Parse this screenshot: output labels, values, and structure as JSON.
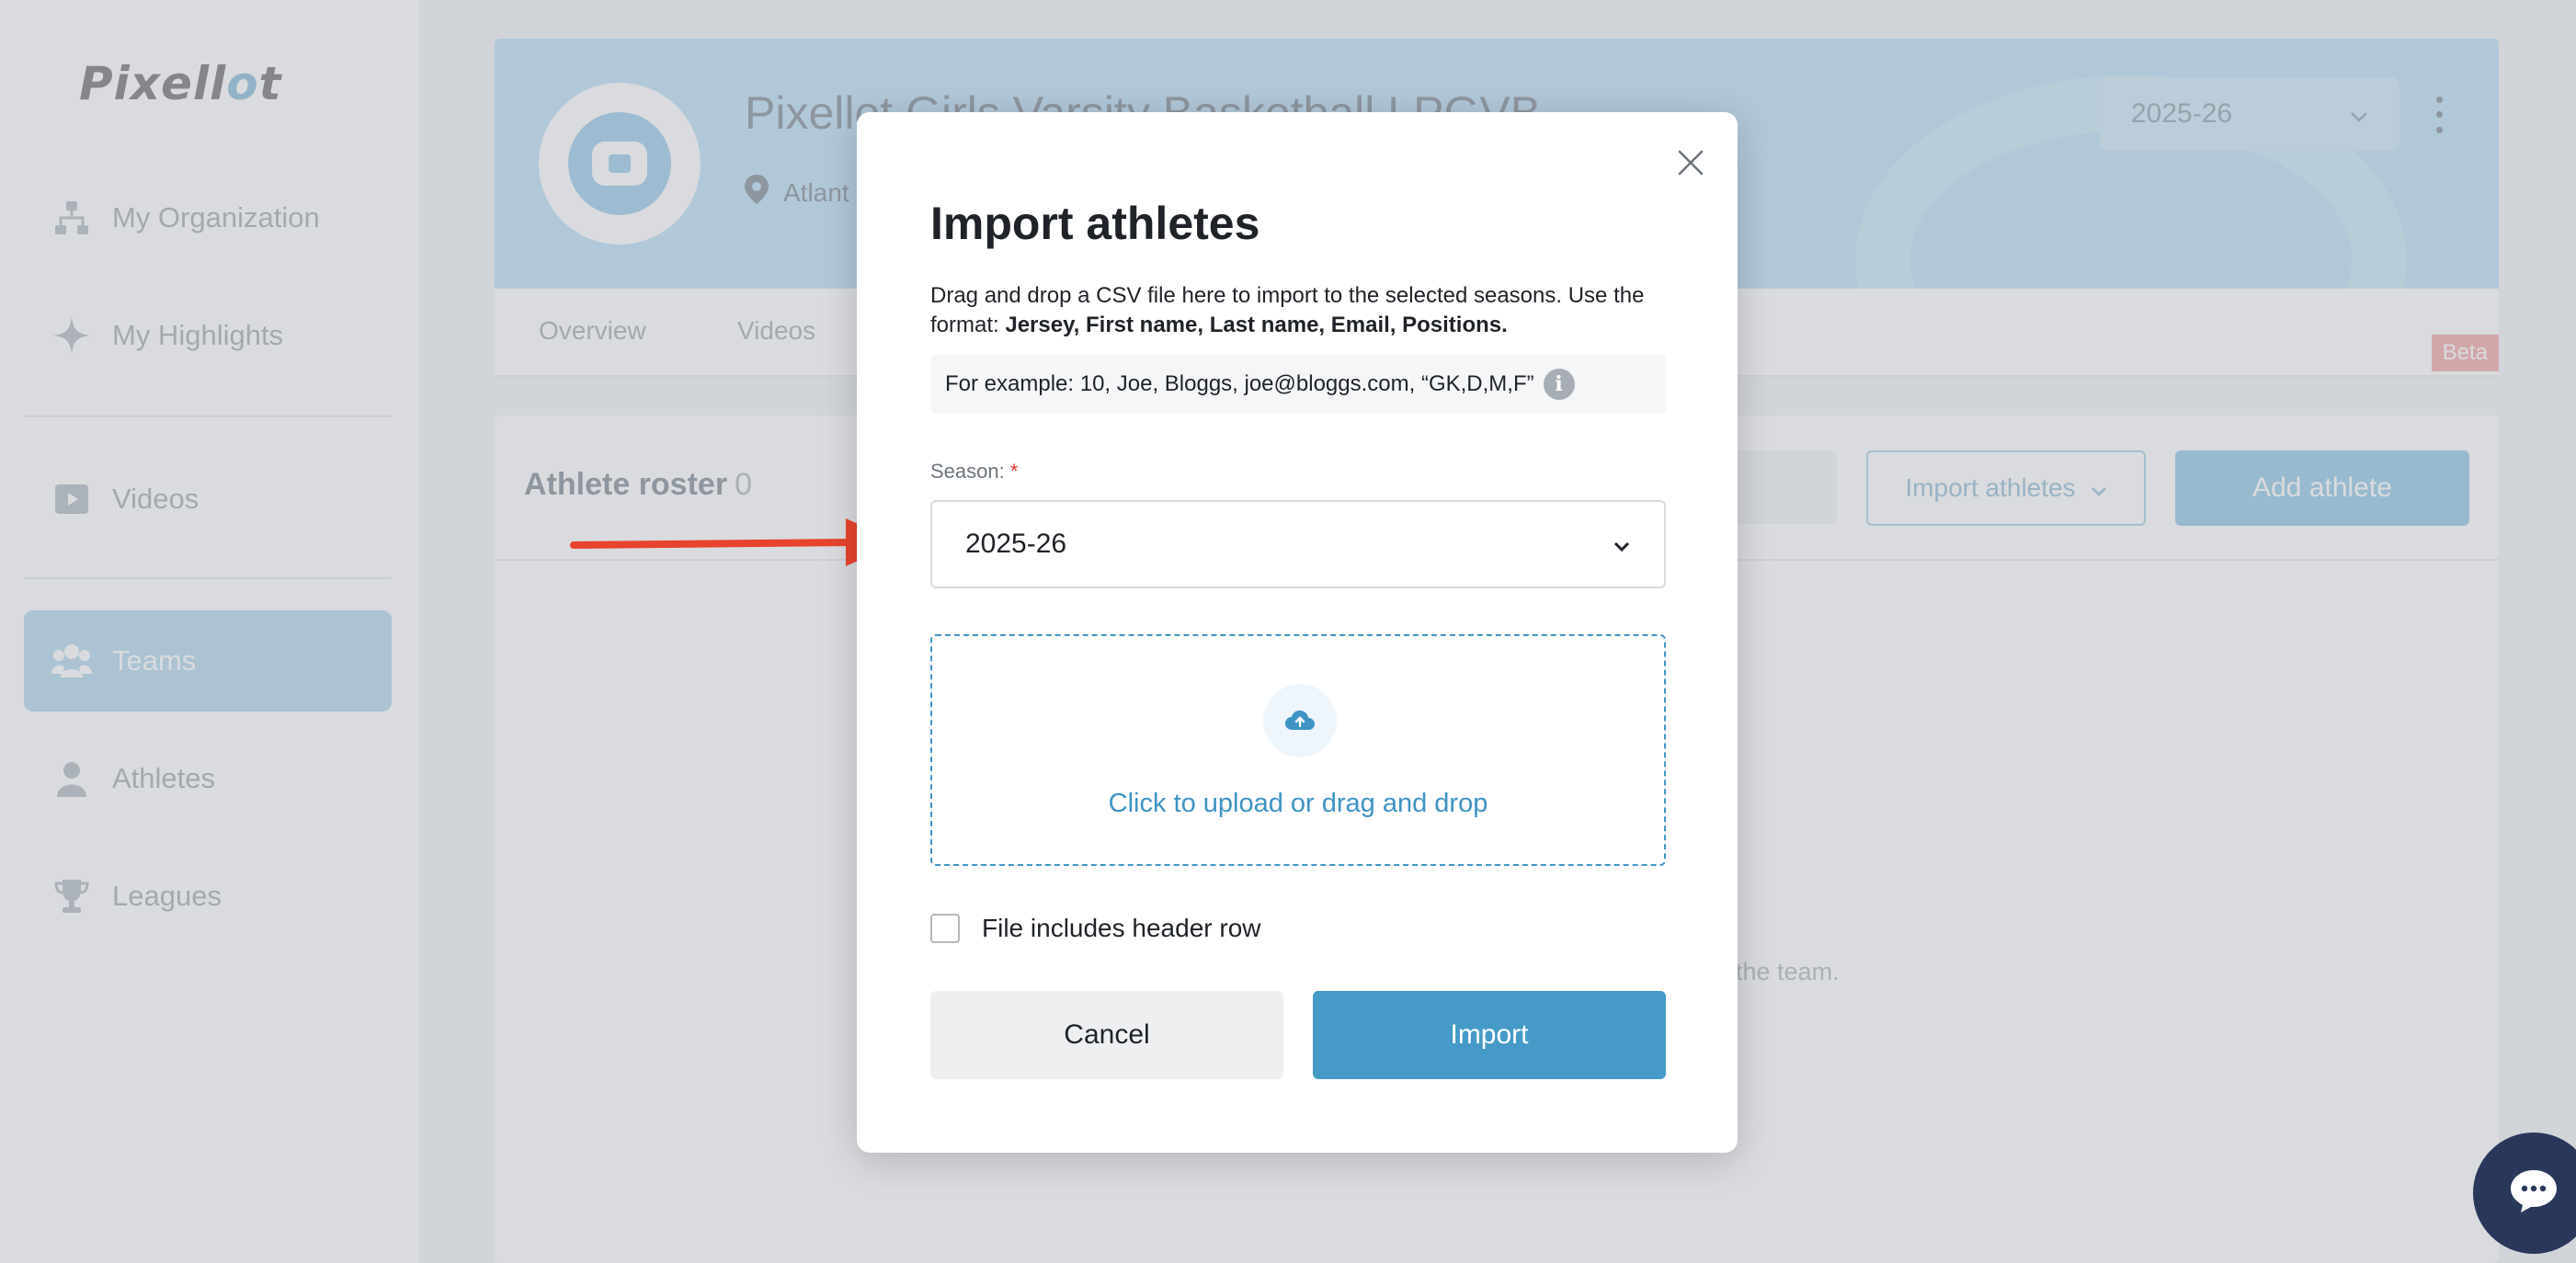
{
  "sidebar": {
    "logo_main": "Pixell",
    "logo_accent": "o",
    "logo_end": "t",
    "items": [
      {
        "label": "My Organization",
        "icon": "org-chart-icon"
      },
      {
        "label": "My Highlights",
        "icon": "sparkle-icon"
      },
      {
        "label": "Videos",
        "icon": "video-icon"
      },
      {
        "label": "Teams",
        "icon": "team-icon",
        "active": true
      },
      {
        "label": "Athletes",
        "icon": "person-icon"
      },
      {
        "label": "Leagues",
        "icon": "trophy-icon"
      }
    ]
  },
  "team": {
    "name": "Pixellot Girls Varsity Basketball LPGVB",
    "location": "Atlant",
    "season": "2025-26"
  },
  "tabs": [
    "Overview",
    "Videos"
  ],
  "beta_label": "Beta",
  "roster": {
    "title": "Athlete roster",
    "count": "0",
    "import_button": "Import athletes",
    "add_button": "Add athlete",
    "empty_text": "the team."
  },
  "modal": {
    "title": "Import athletes",
    "description": "Drag and drop a CSV file here to import to the selected seasons. Use the format: ",
    "format": "Jersey, First name, Last name, Email, Positions.",
    "example": "For example: 10, Joe, Bloggs, joe@bloggs.com, “GK,D,M,F”",
    "season_label": "Season:",
    "season_required": "*",
    "season_value": "2025-26",
    "upload_text": "Click to upload or drag and drop",
    "header_row_label": "File includes header row",
    "cancel_label": "Cancel",
    "import_label": "Import"
  },
  "colors": {
    "accent": "#469ac7",
    "arrow": "#e8432d",
    "chat": "#28375a",
    "required": "#e0342b"
  }
}
